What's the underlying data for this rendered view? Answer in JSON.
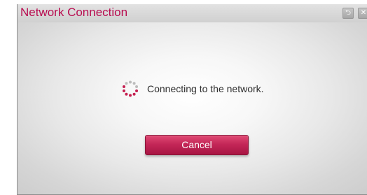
{
  "dialog": {
    "title": "Network Connection",
    "status_text": "Connecting to the network.",
    "cancel_label": "Cancel",
    "back_icon_glyph": "⮌",
    "exit_icon_glyph": "✕"
  },
  "icons": {
    "back": "back-icon",
    "exit": "close-icon",
    "spinner": "loading-spinner-icon"
  },
  "colors": {
    "title_accent": "#b80d50",
    "button_accent": "#c42758",
    "spinner_accent": "#c41f50"
  }
}
